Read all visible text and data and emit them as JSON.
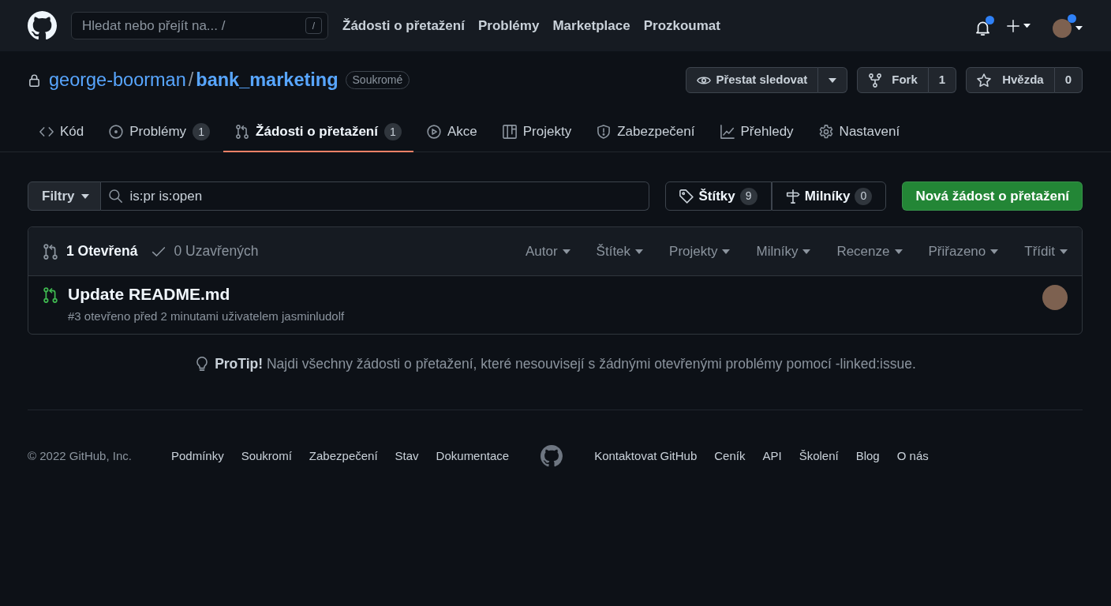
{
  "header": {
    "search": {
      "placeholder": "Hledat nebo přejít na... /",
      "shortcut": "/"
    },
    "nav": [
      {
        "label": "Žádosti o přetažení"
      },
      {
        "label": "Problémy"
      },
      {
        "label": "Marketplace"
      },
      {
        "label": "Prozkoumat"
      }
    ],
    "notifications": {
      "unread": true
    },
    "user_menu": {
      "unread": true
    }
  },
  "repo": {
    "owner": "george-boorman",
    "separator": "/",
    "name": "bank_marketing",
    "visibility": "Soukromé",
    "watch": {
      "label": "Přestat sledovat"
    },
    "fork": {
      "label": "Fork",
      "count": "1"
    },
    "star": {
      "label": "Hvězda",
      "count": "0"
    }
  },
  "tabs": [
    {
      "kind": "code",
      "label": "Kód",
      "selected": false
    },
    {
      "kind": "issues",
      "label": "Problémy",
      "count": "1",
      "selected": false
    },
    {
      "kind": "pulls",
      "label": "Žádosti o přetažení",
      "count": "1",
      "selected": true
    },
    {
      "kind": "actions",
      "label": "Akce",
      "selected": false
    },
    {
      "kind": "projects",
      "label": "Projekty",
      "selected": false
    },
    {
      "kind": "security",
      "label": "Zabezpečení",
      "selected": false
    },
    {
      "kind": "insights",
      "label": "Přehledy",
      "selected": false
    },
    {
      "kind": "settings",
      "label": "Nastavení",
      "selected": false
    }
  ],
  "filter_bar": {
    "filters_button": "Filtry",
    "search_value": "is:pr is:open",
    "labels": {
      "label": "Štítky",
      "count": "9"
    },
    "milestones": {
      "label": "Milníky",
      "count": "0"
    },
    "new_button": "Nová žádost o přetažení"
  },
  "pull_list": {
    "states": [
      {
        "kind": "open",
        "label": "1 Otevřená",
        "selected": true
      },
      {
        "kind": "closed",
        "label": "0 Uzavřených",
        "selected": false
      }
    ],
    "menus": [
      "Autor",
      "Štítek",
      "Projekty",
      "Milníky",
      "Recenze",
      "Přiřazeno",
      "Třídit"
    ],
    "items": [
      {
        "kind": "open",
        "title": "Update README.md",
        "meta": "#3 otevřeno před 2 minutami uživatelem jasminludolf"
      }
    ]
  },
  "protip": {
    "text": "**ProTip!** Najdi všechny žádosti o přetažení, které nesouvisejí s žádnými otevřenými problémy pomocí",
    "link": "-linked:issue",
    "tail": "."
  },
  "footer": {
    "copyright": "© 2022 GitHub, Inc.",
    "links_left": [
      "Podmínky",
      "Soukromí",
      "Zabezpečení",
      "Stav",
      "Dokumentace"
    ],
    "links_right": [
      "Kontaktovat GitHub",
      "Ceník",
      "API",
      "Školení",
      "Blog",
      "O nás"
    ]
  }
}
